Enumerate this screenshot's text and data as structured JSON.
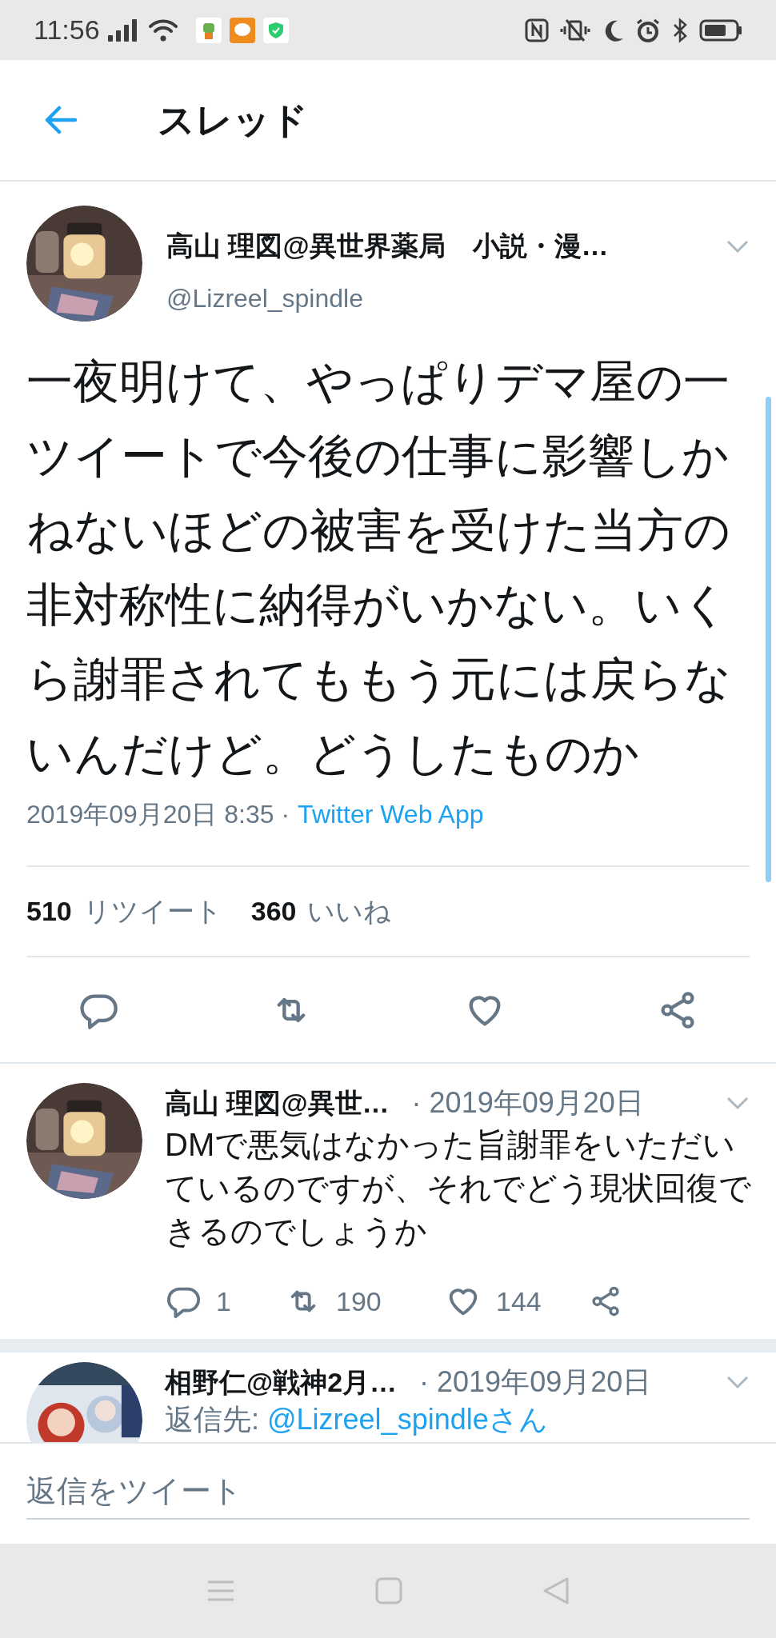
{
  "status_bar": {
    "time": "11:56"
  },
  "header": {
    "title": "スレッド"
  },
  "main_tweet": {
    "display_name": "高山 理図@異世界薬局　小説・漫…",
    "handle": "@Lizreel_spindle",
    "text": "一夜明けて、やっぱりデマ屋の一ツイートで今後の仕事に影響しかねないほどの被害を受けた当方の非対称性に納得がいかない。いくら謝罪されてももう元には戻らないんだけど。どうしたものか",
    "timestamp": "2019年09月20日 8:35 ·",
    "source": "Twitter Web App",
    "stats": [
      {
        "count": "510",
        "label": "リツイート"
      },
      {
        "count": "360",
        "label": "いいね"
      }
    ]
  },
  "replies": [
    {
      "display_name": "高山 理図@異世…",
      "date": "· 2019年09月20日",
      "text": "DMで悪気はなかった旨謝罪をいただいているのですが、それでどう現状回復できるのでしょうか",
      "replies": "1",
      "retweets": "190",
      "likes": "144"
    },
    {
      "display_name": "相野仁@戦神2月…",
      "date": "· 2019年09月20日",
      "reply_to_label": "返信先:",
      "reply_to": "@Lizreel_spindleさん"
    }
  ],
  "reply_field": {
    "placeholder": "返信をツイート"
  }
}
